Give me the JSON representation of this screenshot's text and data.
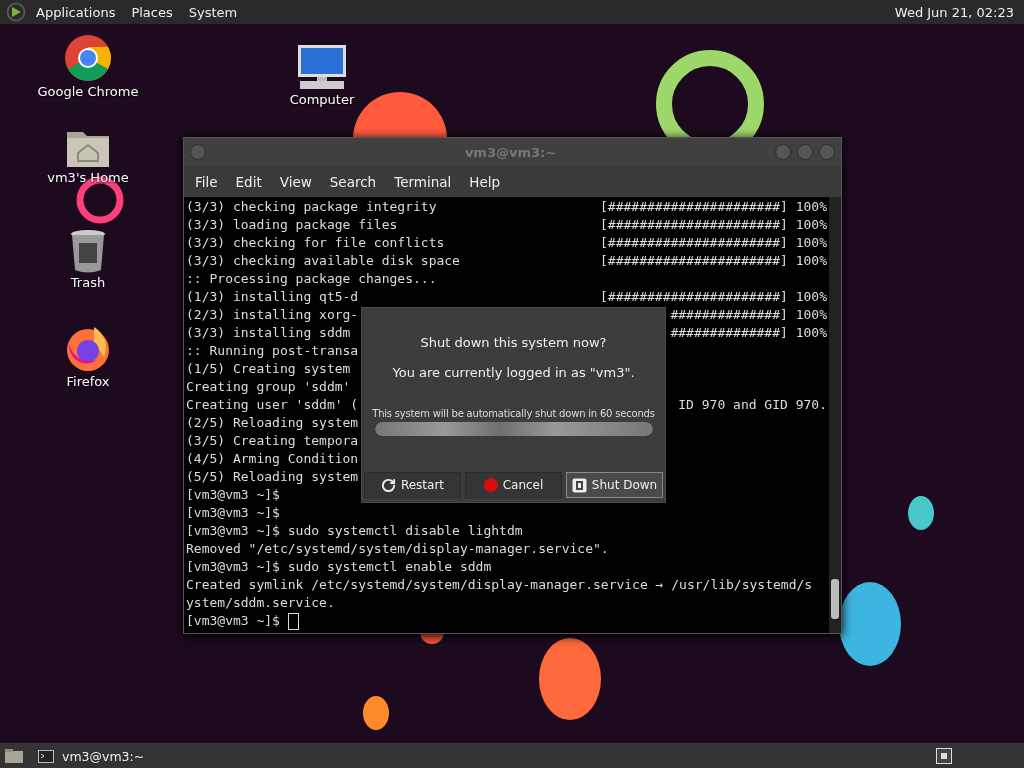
{
  "top_panel": {
    "menus": [
      "Applications",
      "Places",
      "System"
    ],
    "clock": "Wed Jun 21, 02:23"
  },
  "desktop_icons": [
    {
      "label": "Google Chrome",
      "kind": "chrome"
    },
    {
      "label": "vm3's Home",
      "kind": "home"
    },
    {
      "label": "Trash",
      "kind": "trash"
    },
    {
      "label": "Firefox",
      "kind": "firefox"
    },
    {
      "label": "Computer",
      "kind": "computer"
    }
  ],
  "terminal": {
    "title": "vm3@vm3:~",
    "menu": [
      "File",
      "Edit",
      "View",
      "Search",
      "Terminal",
      "Help"
    ],
    "lines": [
      {
        "text": "(3/3) checking package integrity",
        "right": "[######################] 100%"
      },
      {
        "text": "(3/3) loading package files",
        "right": "[######################] 100%"
      },
      {
        "text": "(3/3) checking for file conflicts",
        "right": "[######################] 100%"
      },
      {
        "text": "(3/3) checking available disk space",
        "right": "[######################] 100%"
      },
      {
        "text": ":: Processing package changes..."
      },
      {
        "text": "(1/3) installing qt5-d",
        "right": "[######################] 100%"
      },
      {
        "text": "(2/3) installing xorg-",
        "right": "##############] 100%"
      },
      {
        "text": "(3/3) installing sddm",
        "right": "##############] 100%"
      },
      {
        "text": ":: Running post-transa"
      },
      {
        "text": "(1/5) Creating system"
      },
      {
        "text": "Creating group 'sddm'"
      },
      {
        "text": "Creating user 'sddm' (",
        "right": "ID 970 and GID 970."
      },
      {
        "text": "(2/5) Reloading system"
      },
      {
        "text": "(3/5) Creating tempora"
      },
      {
        "text": "(4/5) Arming Condition"
      },
      {
        "text": "(5/5) Reloading system"
      },
      {
        "text": "[vm3@vm3 ~]$"
      },
      {
        "text": "[vm3@vm3 ~]$"
      },
      {
        "text": "[vm3@vm3 ~]$ sudo systemctl disable lightdm"
      },
      {
        "text": "Removed \"/etc/systemd/system/display-manager.service\"."
      },
      {
        "text": "[vm3@vm3 ~]$ sudo systemctl enable sddm"
      },
      {
        "text": "Created symlink /etc/systemd/system/display-manager.service → /usr/lib/systemd/s"
      },
      {
        "text": "ystem/sddm.service."
      },
      {
        "text": "[vm3@vm3 ~]$",
        "cursor": true
      }
    ]
  },
  "dialog": {
    "title": "Shut down this system now?",
    "message": "You are currently logged in as \"vm3\".",
    "countdown": "This system will be automatically shut down in 60 seconds",
    "level": 1,
    "buttons": [
      {
        "label": "Restart",
        "kind": "restart",
        "selected": false
      },
      {
        "label": "Cancel",
        "kind": "cancel",
        "selected": false
      },
      {
        "label": "Shut Down",
        "kind": "shutdown",
        "selected": true
      }
    ]
  },
  "taskbar": {
    "items": [
      {
        "label": "vm3@vm3:~"
      }
    ]
  }
}
